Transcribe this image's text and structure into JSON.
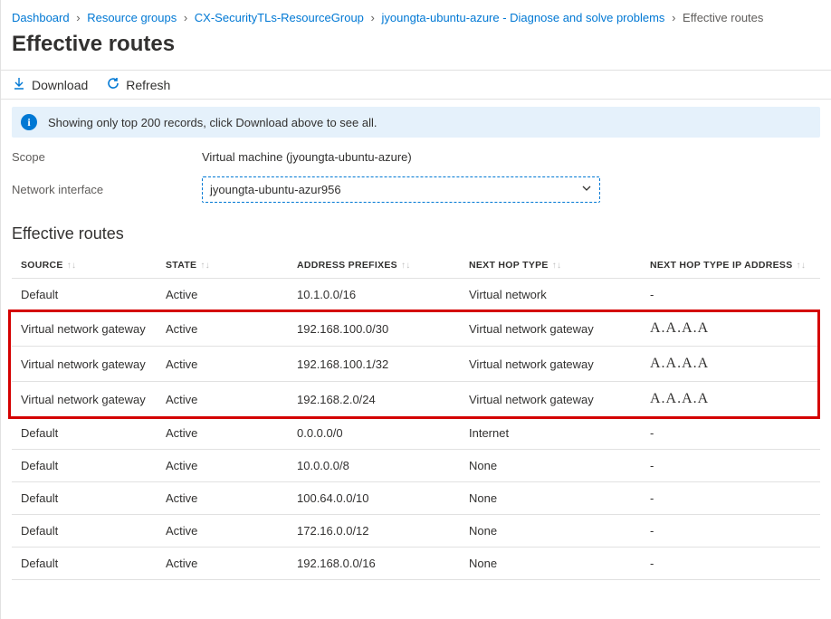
{
  "breadcrumb": {
    "items": [
      {
        "label": "Dashboard"
      },
      {
        "label": "Resource groups"
      },
      {
        "label": "CX-SecurityTLs-ResourceGroup"
      },
      {
        "label": "jyoungta-ubuntu-azure - Diagnose and solve problems"
      }
    ],
    "current": "Effective routes"
  },
  "page_title": "Effective routes",
  "toolbar": {
    "download_label": "Download",
    "refresh_label": "Refresh"
  },
  "info_message": "Showing only top 200 records, click Download above to see all.",
  "form": {
    "scope_label": "Scope",
    "scope_value": "Virtual machine (jyoungta-ubuntu-azure)",
    "nic_label": "Network interface",
    "nic_value": "jyoungta-ubuntu-azur956"
  },
  "section_title": "Effective routes",
  "columns": {
    "source": "SOURCE",
    "state": "STATE",
    "prefix": "ADDRESS PREFIXES",
    "nexthop": "NEXT HOP TYPE",
    "nhip": "NEXT HOP TYPE IP ADDRESS"
  },
  "rows": [
    {
      "source": "Default",
      "state": "Active",
      "prefix": "10.1.0.0/16",
      "nexthop": "Virtual network",
      "nhip": "-",
      "highlight": false
    },
    {
      "source": "Virtual network gateway",
      "state": "Active",
      "prefix": "192.168.100.0/30",
      "nexthop": "Virtual network gateway",
      "nhip": "A.A.A.A",
      "highlight": true
    },
    {
      "source": "Virtual network gateway",
      "state": "Active",
      "prefix": "192.168.100.1/32",
      "nexthop": "Virtual network gateway",
      "nhip": "A.A.A.A",
      "highlight": true
    },
    {
      "source": "Virtual network gateway",
      "state": "Active",
      "prefix": "192.168.2.0/24",
      "nexthop": "Virtual network gateway",
      "nhip": "A.A.A.A",
      "highlight": true
    },
    {
      "source": "Default",
      "state": "Active",
      "prefix": "0.0.0.0/0",
      "nexthop": "Internet",
      "nhip": "-",
      "highlight": false
    },
    {
      "source": "Default",
      "state": "Active",
      "prefix": "10.0.0.0/8",
      "nexthop": "None",
      "nhip": "-",
      "highlight": false
    },
    {
      "source": "Default",
      "state": "Active",
      "prefix": "100.64.0.0/10",
      "nexthop": "None",
      "nhip": "-",
      "highlight": false
    },
    {
      "source": "Default",
      "state": "Active",
      "prefix": "172.16.0.0/12",
      "nexthop": "None",
      "nhip": "-",
      "highlight": false
    },
    {
      "source": "Default",
      "state": "Active",
      "prefix": "192.168.0.0/16",
      "nexthop": "None",
      "nhip": "-",
      "highlight": false
    }
  ]
}
